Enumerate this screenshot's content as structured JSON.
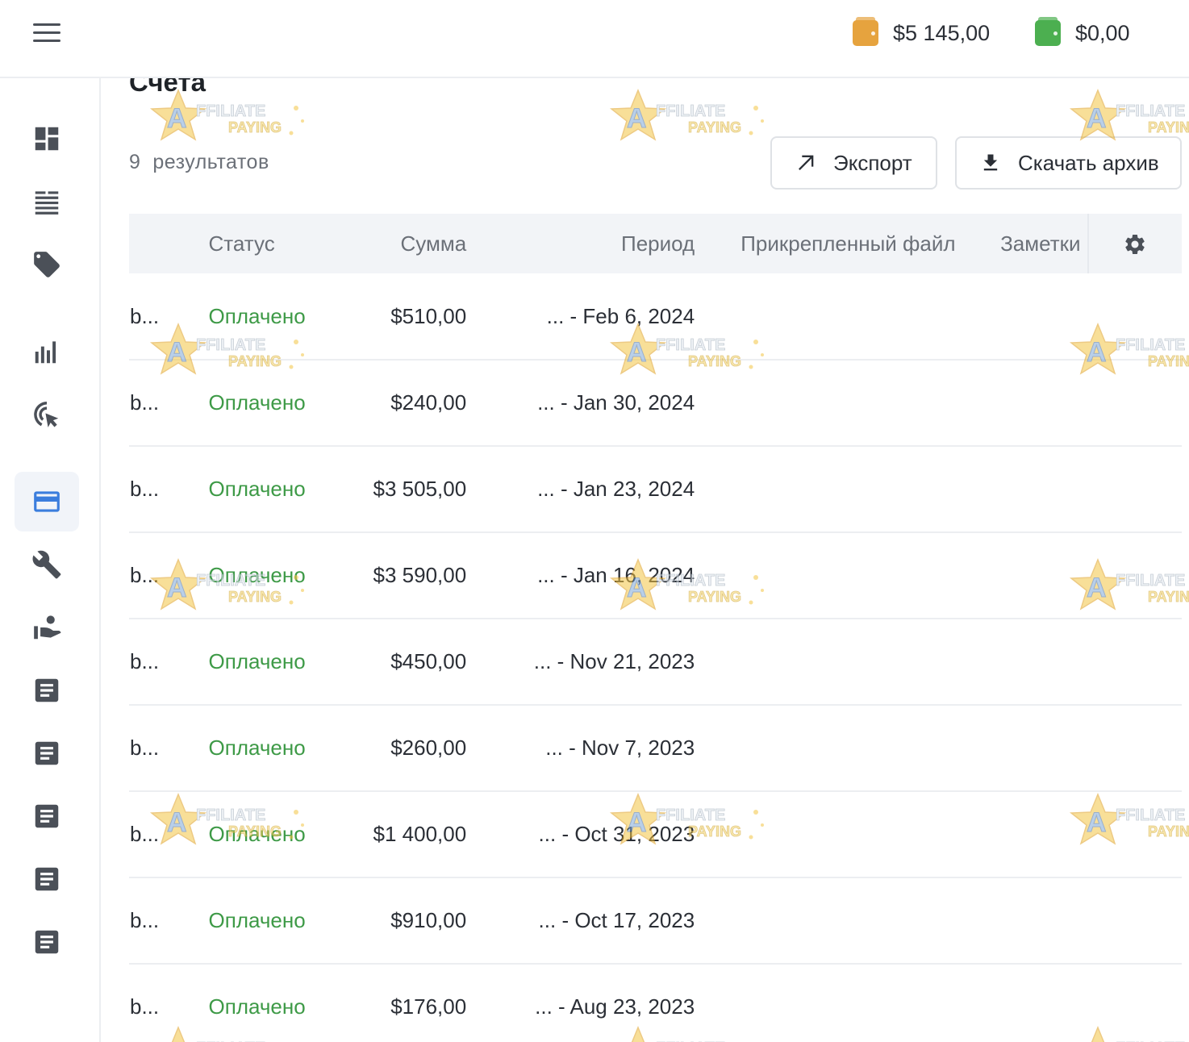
{
  "header": {
    "menu_icon": "hamburger-icon",
    "balances": [
      {
        "icon": "wallet-icon",
        "color": "#e6a33e",
        "value": "$5 145,00"
      },
      {
        "icon": "wallet-icon",
        "color": "#4caf50",
        "value": "$0,00"
      }
    ]
  },
  "sidebar": {
    "items": [
      {
        "icon": "dashboard-icon"
      },
      {
        "icon": "list-icon"
      },
      {
        "icon": "tag-icon"
      },
      {
        "icon": "bar-chart-icon"
      },
      {
        "icon": "click-target-icon"
      },
      {
        "icon": "credit-card-icon",
        "active": true
      },
      {
        "icon": "wrench-icon"
      },
      {
        "icon": "referral-icon"
      },
      {
        "icon": "document-icon"
      },
      {
        "icon": "document-icon"
      },
      {
        "icon": "document-icon"
      },
      {
        "icon": "document-icon"
      },
      {
        "icon": "document-icon"
      }
    ],
    "active_color": "#3b7ddd"
  },
  "page": {
    "title": "Счета",
    "results_count": "9",
    "results_label": "результатов",
    "export_label": "Экспорт",
    "archive_label": "Скачать архив"
  },
  "table": {
    "columns": {
      "id": "",
      "status": "Статус",
      "sum": "Сумма",
      "period": "Период",
      "file": "Прикрепленный файл",
      "notes": "Заметки"
    },
    "rows": [
      {
        "id": "b...",
        "status": "Оплачено",
        "sum": "$510,00",
        "period": "... - Feb 6, 2024"
      },
      {
        "id": "b...",
        "status": "Оплачено",
        "sum": "$240,00",
        "period": "... - Jan 30, 2024"
      },
      {
        "id": "b...",
        "status": "Оплачено",
        "sum": "$3 505,00",
        "period": "... - Jan 23, 2024"
      },
      {
        "id": "b...",
        "status": "Оплачено",
        "sum": "$3 590,00",
        "period": "... - Jan 16, 2024"
      },
      {
        "id": "b...",
        "status": "Оплачено",
        "sum": "$450,00",
        "period": "... - Nov 21, 2023"
      },
      {
        "id": "b...",
        "status": "Оплачено",
        "sum": "$260,00",
        "period": "... - Nov 7, 2023"
      },
      {
        "id": "b...",
        "status": "Оплачено",
        "sum": "$1 400,00",
        "period": "... - Oct 31, 2023"
      },
      {
        "id": "b...",
        "status": "Оплачено",
        "sum": "$910,00",
        "period": "... - Oct 17, 2023"
      },
      {
        "id": "b...",
        "status": "Оплачено",
        "sum": "$176,00",
        "period": "... - Aug 23, 2023"
      }
    ],
    "status_color": "#3e9a47"
  },
  "watermark": {
    "line1": "AFFILIATE",
    "line2": "PAYING"
  }
}
